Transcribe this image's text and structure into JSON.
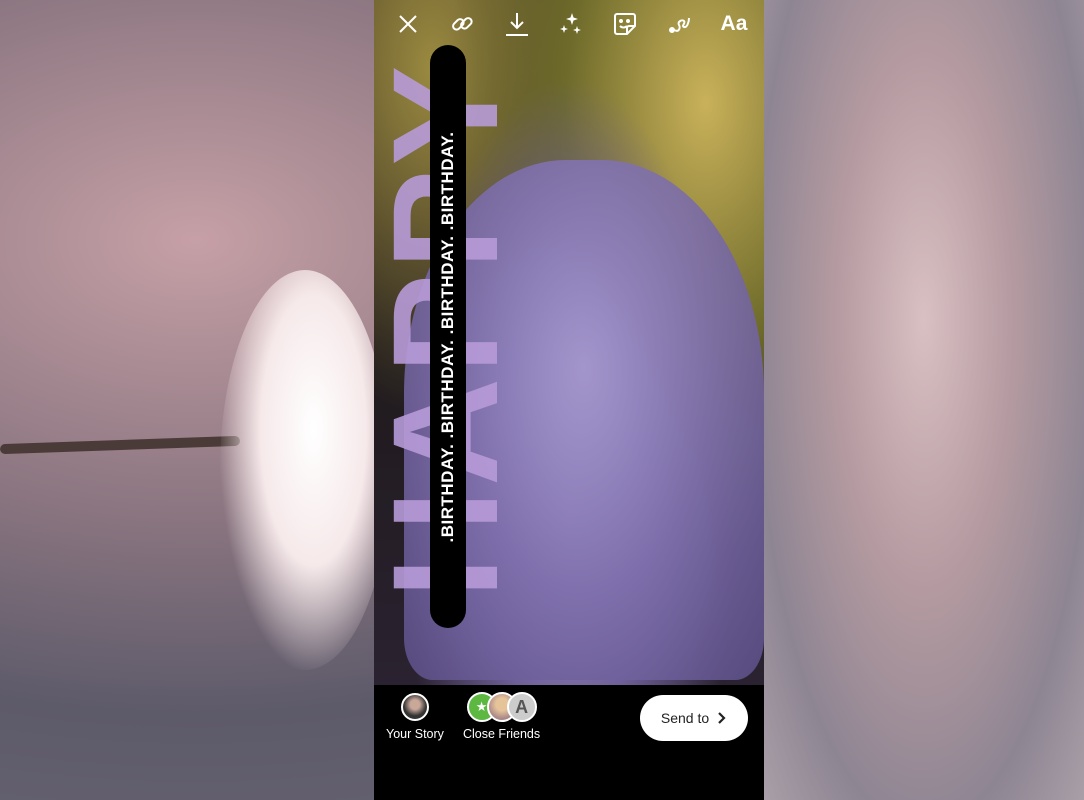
{
  "toolbar": {
    "icons": [
      "close-icon",
      "link-icon",
      "download-icon",
      "effects-sparkle-icon",
      "sticker-icon",
      "draw-icon",
      "text-icon"
    ],
    "text_label": "Aa"
  },
  "story": {
    "happy_text": "HAPPY",
    "banner_text": ".BIRTHDAY. .BIRTHDAY. .BIRTHDAY. .BIRTHDAY."
  },
  "share": {
    "your_story": "Your Story",
    "close_friends": "Close Friends",
    "send_to": "Send to",
    "close_friends_color": "#5cb841"
  }
}
